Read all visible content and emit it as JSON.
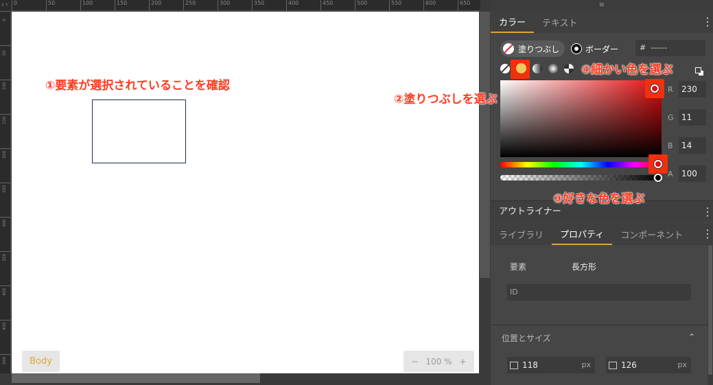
{
  "ruler": {
    "corner": "X Y",
    "top_ticks": [
      "0",
      "50",
      "100",
      "150",
      "200",
      "250",
      "300",
      "350",
      "400",
      "450",
      "500",
      "550",
      "600",
      "650"
    ],
    "left_ticks": [
      "0",
      "50",
      "100",
      "150",
      "200",
      "250",
      "300",
      "350",
      "400",
      "450",
      "500"
    ]
  },
  "canvas": {
    "body_label": "Body",
    "zoom": {
      "minus": "−",
      "value": "100",
      "unit": "%",
      "plus": "+"
    }
  },
  "annotations": {
    "a1": "①要素が選択されていることを確認",
    "a2": "②塗りつぶしを選ぶ",
    "a3": "③好きな色を選ぶ",
    "a4": "④細かい色を選ぶ"
  },
  "panel": {
    "handle": "≡",
    "color_tabs": [
      {
        "label": "カラー",
        "active": true
      },
      {
        "label": "テキスト",
        "active": false
      }
    ],
    "fill_label": "塗りつぶし",
    "border_label": "ボーダー",
    "hex_prefix": "#",
    "hex_value": "------",
    "rgba": {
      "r_label": "R",
      "r": "230",
      "g_label": "G",
      "g": "11",
      "b_label": "B",
      "b": "14",
      "a_label": "A",
      "a": "100"
    },
    "current_color": "#e60b0e",
    "outliner_title": "アウトライナー",
    "prop_tabs": [
      {
        "label": "ライブラリ",
        "active": false
      },
      {
        "label": "プロパティ",
        "active": true
      },
      {
        "label": "コンポーネント",
        "active": false
      }
    ],
    "element_label": "要素",
    "element_value": "長方形",
    "id_placeholder": "ID",
    "pos_size_title": "位置とサイズ",
    "collapse": "⌃",
    "x_value": "118",
    "y_value": "126",
    "unit": "px",
    "kebab": "⋮"
  }
}
